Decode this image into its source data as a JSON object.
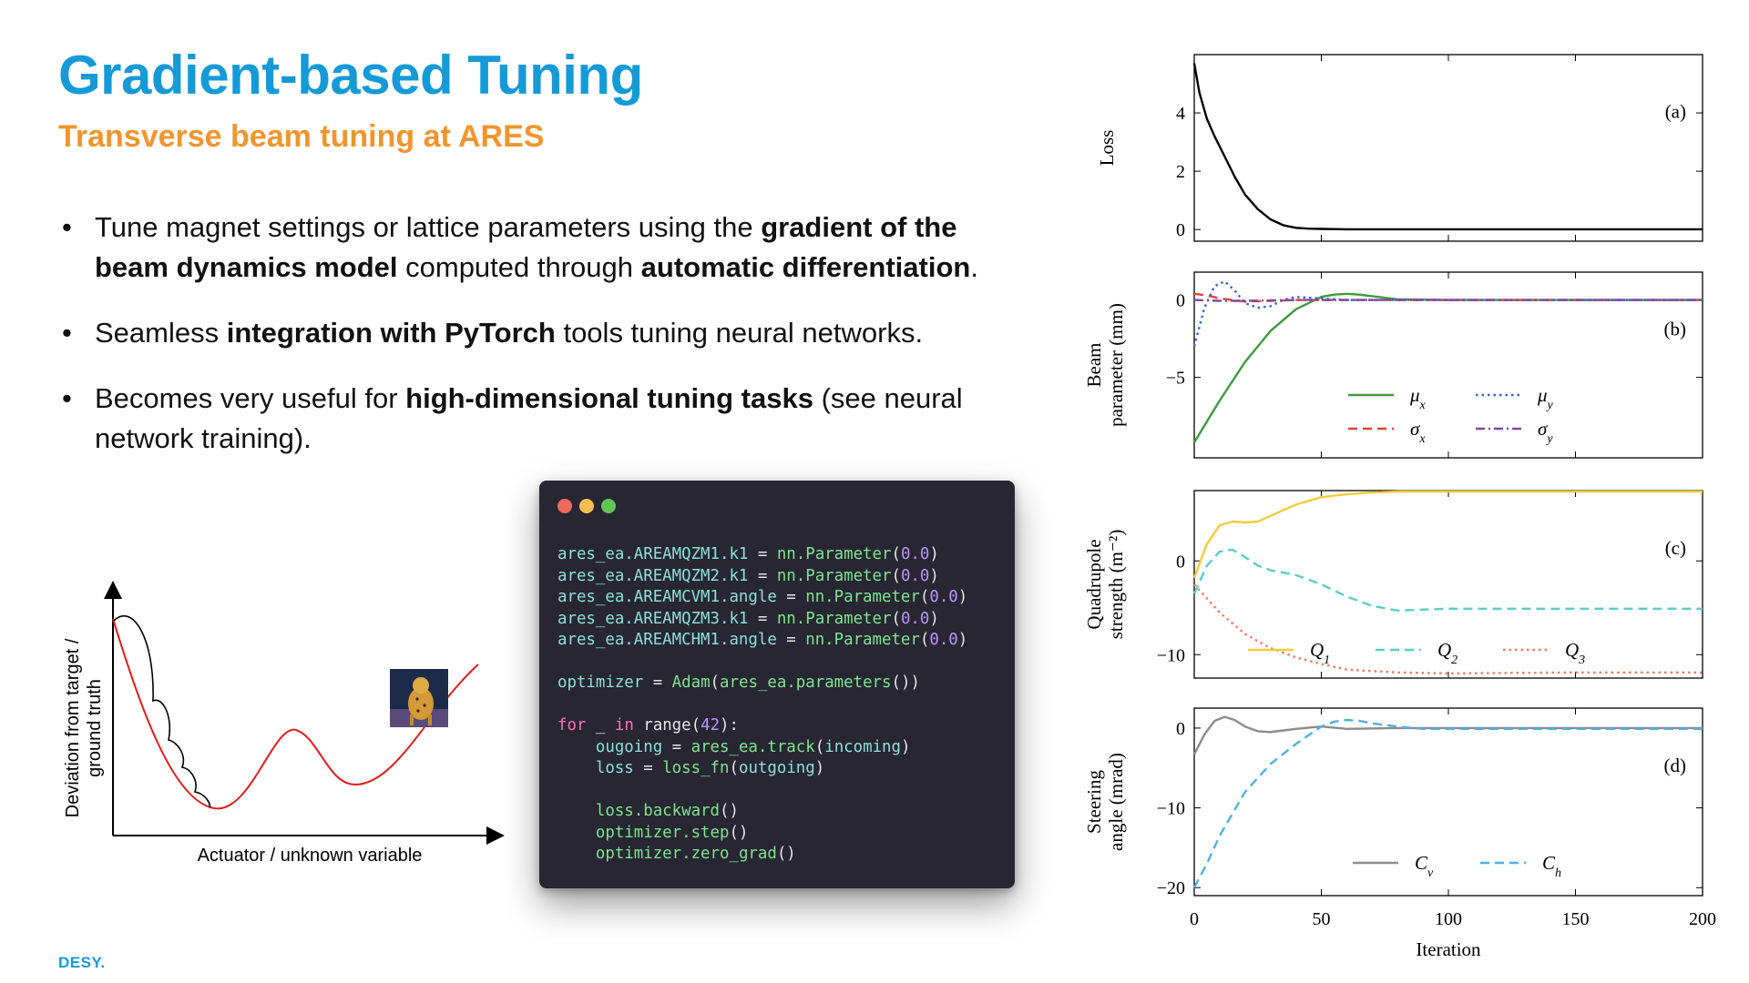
{
  "slide": {
    "title": "Gradient-based Tuning",
    "subtitle": "Transverse beam tuning at ARES",
    "logo": "DESY."
  },
  "bullets": [
    [
      {
        "t": "Tune magnet settings or lattice parameters using the ",
        "b": false
      },
      {
        "t": "gradient of the beam dynamics model",
        "b": true
      },
      {
        "t": " computed through ",
        "b": false
      },
      {
        "t": "automatic differentiation",
        "b": true
      },
      {
        "t": ".",
        "b": false
      }
    ],
    [
      {
        "t": "Seamless ",
        "b": false
      },
      {
        "t": "integration with PyTorch",
        "b": true
      },
      {
        "t": " tools tuning neural networks.",
        "b": false
      }
    ],
    [
      {
        "t": "Becomes very useful for ",
        "b": false
      },
      {
        "t": "high-dimensional tuning tasks",
        "b": true
      },
      {
        "t": " (see neural network training).",
        "b": false
      }
    ]
  ],
  "sketch": {
    "ylabel_line1": "Deviation from target /",
    "ylabel_line2": "ground truth",
    "xlabel": "Actuator / unknown variable",
    "image_icon": "cheetah-photo-icon"
  },
  "code_window": {
    "dots": [
      "#ec6a5e",
      "#f4bf4f",
      "#61c554"
    ],
    "lines": [
      [
        [
          "v",
          "ares_ea.AREAMQZM1.k1"
        ],
        [
          "p",
          " = "
        ],
        [
          "f",
          "nn.Parameter"
        ],
        [
          "p",
          "("
        ],
        [
          "n",
          "0.0"
        ],
        [
          "p",
          ")"
        ]
      ],
      [
        [
          "v",
          "ares_ea.AREAMQZM2.k1"
        ],
        [
          "p",
          " = "
        ],
        [
          "f",
          "nn.Parameter"
        ],
        [
          "p",
          "("
        ],
        [
          "n",
          "0.0"
        ],
        [
          "p",
          ")"
        ]
      ],
      [
        [
          "v",
          "ares_ea.AREAMCVM1.angle"
        ],
        [
          "p",
          " = "
        ],
        [
          "f",
          "nn.Parameter"
        ],
        [
          "p",
          "("
        ],
        [
          "n",
          "0.0"
        ],
        [
          "p",
          ")"
        ]
      ],
      [
        [
          "v",
          "ares_ea.AREAMQZM3.k1"
        ],
        [
          "p",
          " = "
        ],
        [
          "f",
          "nn.Parameter"
        ],
        [
          "p",
          "("
        ],
        [
          "n",
          "0.0"
        ],
        [
          "p",
          ")"
        ]
      ],
      [
        [
          "v",
          "ares_ea.AREAMCHM1.angle"
        ],
        [
          "p",
          " = "
        ],
        [
          "f",
          "nn.Parameter"
        ],
        [
          "p",
          "("
        ],
        [
          "n",
          "0.0"
        ],
        [
          "p",
          ")"
        ]
      ],
      [],
      [
        [
          "v",
          "optimizer"
        ],
        [
          "p",
          " = "
        ],
        [
          "f",
          "Adam"
        ],
        [
          "p",
          "("
        ],
        [
          "f",
          "ares_ea.parameters"
        ],
        [
          "p",
          "())"
        ]
      ],
      [],
      [
        [
          "k",
          "for"
        ],
        [
          "p",
          " _ "
        ],
        [
          "k",
          "in"
        ],
        [
          "p",
          " range("
        ],
        [
          "n",
          "42"
        ],
        [
          "p",
          "):"
        ]
      ],
      [
        [
          "p",
          "    "
        ],
        [
          "v",
          "ougoing"
        ],
        [
          "p",
          " = "
        ],
        [
          "f",
          "ares_ea.track"
        ],
        [
          "p",
          "("
        ],
        [
          "v",
          "incoming"
        ],
        [
          "p",
          ")"
        ]
      ],
      [
        [
          "p",
          "    "
        ],
        [
          "v",
          "loss"
        ],
        [
          "p",
          " = "
        ],
        [
          "f",
          "loss_fn"
        ],
        [
          "p",
          "("
        ],
        [
          "v",
          "outgoing"
        ],
        [
          "p",
          ")"
        ]
      ],
      [],
      [
        [
          "p",
          "    "
        ],
        [
          "f",
          "loss.backward"
        ],
        [
          "p",
          "()"
        ]
      ],
      [
        [
          "p",
          "    "
        ],
        [
          "f",
          "optimizer.step"
        ],
        [
          "p",
          "()"
        ]
      ],
      [
        [
          "p",
          "    "
        ],
        [
          "f",
          "optimizer.zero_grad"
        ],
        [
          "p",
          "()"
        ]
      ]
    ]
  },
  "chart_data": [
    {
      "type": "line",
      "panel": "(a)",
      "ylabel": [
        "Loss"
      ],
      "xlim": [
        0,
        200
      ],
      "ylim": [
        -0.4,
        6
      ],
      "yticks": [
        0,
        2,
        4
      ],
      "series": [
        {
          "color": "#000000",
          "dash": "solid",
          "x": [
            0,
            2,
            5,
            8,
            12,
            16,
            20,
            25,
            30,
            35,
            40,
            45,
            50,
            60,
            80,
            100,
            150,
            200
          ],
          "y": [
            5.7,
            4.7,
            3.8,
            3.2,
            2.5,
            1.8,
            1.2,
            0.7,
            0.35,
            0.15,
            0.06,
            0.03,
            0.02,
            0.01,
            0.01,
            0.01,
            0.01,
            0.01
          ]
        }
      ]
    },
    {
      "type": "line",
      "panel": "(b)",
      "ylabel": [
        "Beam",
        "parameter (mm)"
      ],
      "xlim": [
        0,
        200
      ],
      "ylim": [
        -10.2,
        1.8
      ],
      "yticks": [
        0,
        -5
      ],
      "legend": [
        {
          "label": "μ",
          "sub": "x",
          "ref": 0
        },
        {
          "label": "μ",
          "sub": "y",
          "ref": 2
        },
        {
          "label": "σ",
          "sub": "x",
          "ref": 1
        },
        {
          "label": "σ",
          "sub": "y",
          "ref": 3
        }
      ],
      "series": [
        {
          "color": "#3d9a3d",
          "dash": "solid",
          "x": [
            0,
            10,
            20,
            30,
            40,
            50,
            55,
            60,
            65,
            70,
            80,
            100,
            150,
            200
          ],
          "y": [
            -9.2,
            -6.5,
            -4.0,
            -2.0,
            -0.6,
            0.2,
            0.35,
            0.4,
            0.35,
            0.25,
            0.05,
            0.0,
            0.0,
            0.0
          ]
        },
        {
          "color": "#e0433a",
          "dash": "10,6",
          "x": [
            0,
            5,
            10,
            20,
            30,
            40,
            60,
            100,
            200
          ],
          "y": [
            0.4,
            0.3,
            0.1,
            -0.1,
            -0.05,
            0.0,
            0.0,
            0.0,
            0.0
          ]
        },
        {
          "color": "#3a63c9",
          "dash": "2.5,4",
          "x": [
            0,
            4,
            8,
            12,
            16,
            20,
            25,
            30,
            35,
            40,
            50,
            60,
            80,
            100,
            200
          ],
          "y": [
            -3.0,
            -0.5,
            0.9,
            1.2,
            0.6,
            -0.2,
            -0.5,
            -0.4,
            0.0,
            0.2,
            0.1,
            0.0,
            0.0,
            0.0,
            0.0
          ]
        },
        {
          "color": "#7b4aa6",
          "dash": "10,4,2,4",
          "x": [
            0,
            10,
            20,
            40,
            60,
            100,
            200
          ],
          "y": [
            0.0,
            -0.05,
            -0.05,
            0.0,
            0.0,
            0.0,
            0.0
          ]
        }
      ]
    },
    {
      "type": "line",
      "panel": "(c)",
      "ylabel": [
        "Quadrupole",
        "strength (m⁻²)"
      ],
      "xlim": [
        0,
        200
      ],
      "ylim": [
        -12.5,
        7.5
      ],
      "yticks": [
        0,
        -10
      ],
      "legend": [
        {
          "label": "Q",
          "sub": "1",
          "ref": 0
        },
        {
          "label": "Q",
          "sub": "2",
          "ref": 1
        },
        {
          "label": "Q",
          "sub": "3",
          "ref": 2
        }
      ],
      "series": [
        {
          "color": "#f3cc3a",
          "dash": "solid",
          "x": [
            0,
            5,
            10,
            15,
            20,
            25,
            30,
            40,
            50,
            60,
            70,
            80,
            100,
            150,
            200
          ],
          "y": [
            -1.8,
            1.8,
            3.8,
            4.2,
            4.1,
            4.2,
            4.8,
            6.0,
            6.8,
            7.1,
            7.3,
            7.4,
            7.4,
            7.4,
            7.4
          ]
        },
        {
          "color": "#57cec8",
          "dash": "10,6",
          "x": [
            0,
            5,
            10,
            15,
            20,
            25,
            30,
            40,
            50,
            60,
            70,
            80,
            100,
            150,
            200
          ],
          "y": [
            -3.5,
            -0.5,
            1.0,
            1.2,
            0.4,
            -0.5,
            -1.0,
            -1.5,
            -2.5,
            -3.8,
            -4.8,
            -5.3,
            -5.1,
            -5.1,
            -5.1
          ]
        },
        {
          "color": "#f07a5f",
          "dash": "2.5,4",
          "x": [
            0,
            5,
            10,
            20,
            30,
            40,
            50,
            60,
            80,
            100,
            150,
            200
          ],
          "y": [
            -2.5,
            -4.0,
            -5.5,
            -7.8,
            -9.3,
            -10.3,
            -11.0,
            -11.6,
            -11.9,
            -12.0,
            -11.9,
            -11.9
          ]
        }
      ]
    },
    {
      "type": "line",
      "panel": "(d)",
      "ylabel": [
        "Steering",
        "angle (mrad)"
      ],
      "xlim": [
        0,
        200
      ],
      "ylim": [
        -21,
        2.5
      ],
      "yticks": [
        0,
        -10,
        -20
      ],
      "xticks": [
        0,
        50,
        100,
        150,
        200
      ],
      "xlabel": "Iteration",
      "legend": [
        {
          "label": "C",
          "sub": "v",
          "ref": 0
        },
        {
          "label": "C",
          "sub": "h",
          "ref": 1
        }
      ],
      "series": [
        {
          "color": "#8c8c8c",
          "dash": "solid",
          "x": [
            0,
            4,
            8,
            12,
            16,
            20,
            25,
            30,
            40,
            50,
            60,
            80,
            100,
            150,
            200
          ],
          "y": [
            -3.3,
            -0.8,
            0.9,
            1.4,
            1.0,
            0.2,
            -0.4,
            -0.5,
            -0.1,
            0.2,
            -0.1,
            0.0,
            0.0,
            0.0,
            0.0
          ]
        },
        {
          "color": "#4fb0e0",
          "dash": "10,6",
          "x": [
            0,
            5,
            10,
            20,
            30,
            40,
            50,
            55,
            60,
            65,
            70,
            80,
            90,
            100,
            150,
            200
          ],
          "y": [
            -20.0,
            -17.0,
            -13.5,
            -8.0,
            -4.5,
            -2.0,
            0.2,
            0.8,
            1.0,
            0.9,
            0.6,
            0.2,
            -0.1,
            -0.1,
            -0.1,
            -0.1
          ]
        }
      ]
    }
  ]
}
